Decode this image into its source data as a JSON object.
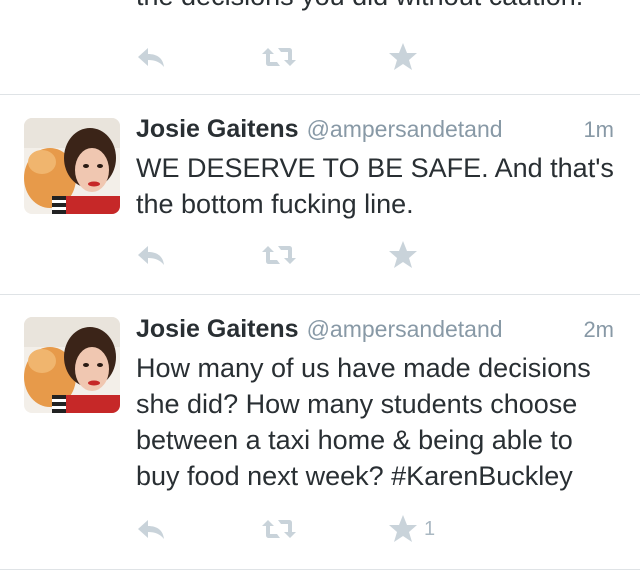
{
  "colors": {
    "icon_gray": "#c9d3da",
    "text": "#292f33",
    "secondary": "#8899a6",
    "divider": "#dfe3e6"
  },
  "tweets": [
    {
      "text": "the decisions you did without caution.",
      "actions": {
        "reply_icon": "reply-icon",
        "retweet_icon": "retweet-icon",
        "favorite_icon": "star-icon"
      }
    },
    {
      "name": "Josie Gaitens",
      "handle": "@ampersandetand",
      "time": "1m",
      "text": "WE DESERVE TO BE SAFE. And that's the bottom fucking line.",
      "actions": {
        "reply_icon": "reply-icon",
        "retweet_icon": "retweet-icon",
        "favorite_icon": "star-icon"
      }
    },
    {
      "name": "Josie Gaitens",
      "handle": "@ampersandetand",
      "time": "2m",
      "text": "How many of us have made decisions she did? How many students choose between a taxi home & being able to buy food next week? #KarenBuckley",
      "actions": {
        "reply_icon": "reply-icon",
        "retweet_icon": "retweet-icon",
        "favorite_icon": "star-icon",
        "favorite_count": "1"
      }
    }
  ]
}
